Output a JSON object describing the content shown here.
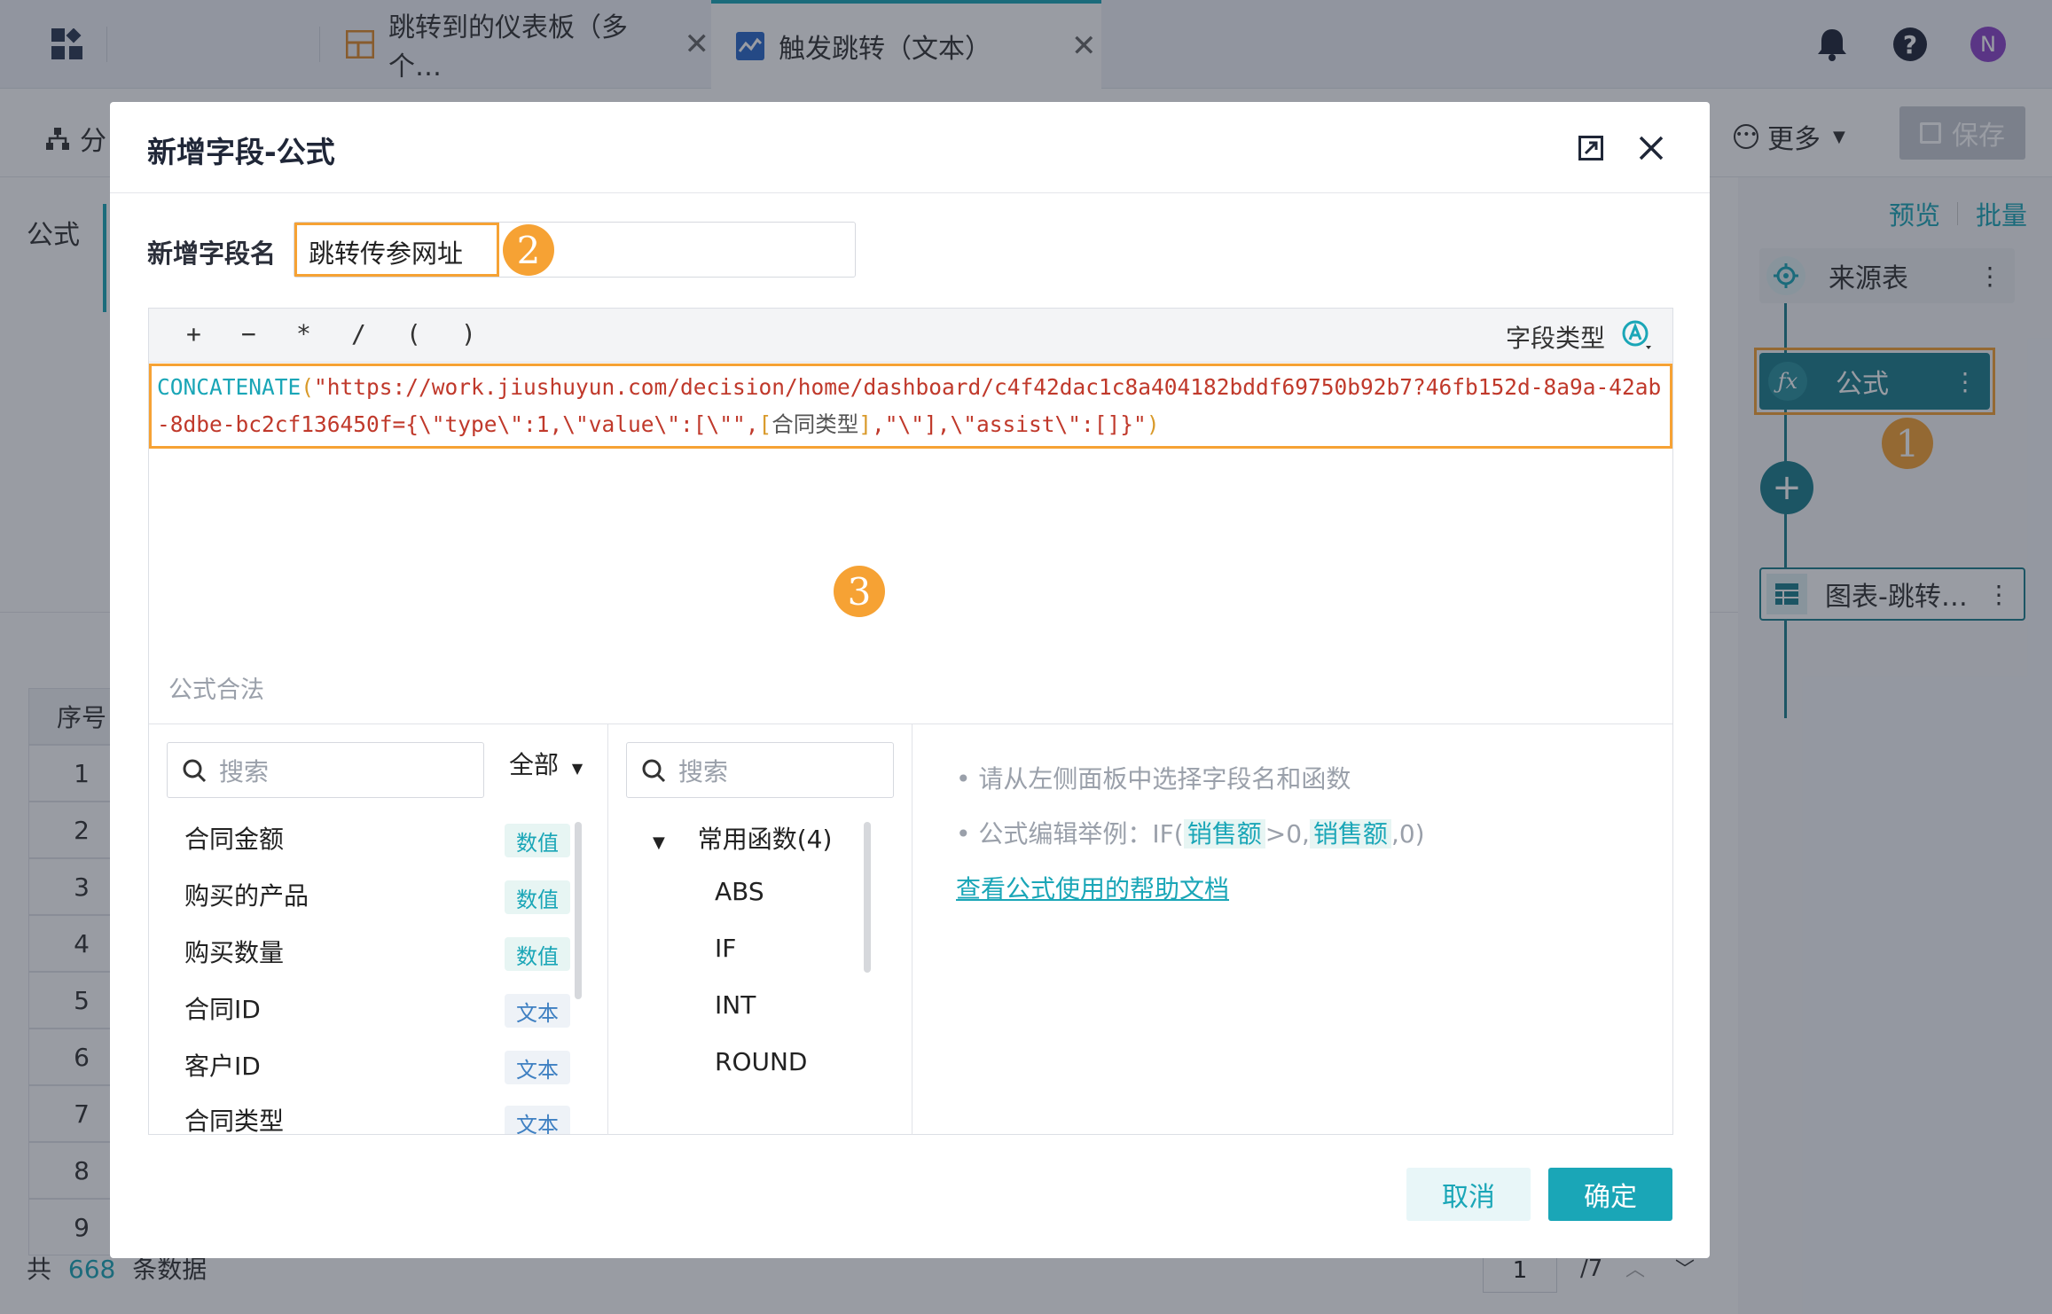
{
  "tabs": [
    {
      "label": "跳转到的仪表板（多个…",
      "close": "✕"
    },
    {
      "label": "触发跳转（文本）",
      "close": "✕"
    }
  ],
  "header": {
    "user_initial": "N"
  },
  "toolbar": {
    "left_label": "分",
    "more_label": "更多",
    "save_label": "保存"
  },
  "left": {
    "formula_label": "公式",
    "col_header": "序号",
    "row_numbers": [
      "1",
      "2",
      "3",
      "4",
      "5",
      "6",
      "7",
      "8",
      "9"
    ]
  },
  "footer": {
    "total_prefix": "共",
    "total_count": "668",
    "total_suffix": "条数据",
    "page": "1",
    "page_total": "/7"
  },
  "right": {
    "preview": "预览",
    "batch": "批量",
    "nodes": [
      {
        "label": "来源表",
        "icon": "source-icon"
      },
      {
        "label": "公式",
        "icon": "fx-icon"
      },
      {
        "label": "图表-跳转…",
        "icon": "table-icon"
      }
    ],
    "markers": {
      "one": "1"
    }
  },
  "dialog": {
    "title": "新增字段-公式",
    "field_name_label": "新增字段名",
    "field_name_value": "跳转传参网址",
    "markers": {
      "two": "2",
      "three": "3"
    },
    "operators": [
      "+",
      "−",
      "*",
      "/",
      "(",
      ")"
    ],
    "field_type_label": "字段类型",
    "formula": {
      "fn": "CONCATENATE",
      "open": "(",
      "str1": "\"https://work.jiushuyun.com/decision/home/dashboard/c4f42dac1c8a404182bddf69750b92b7?46fb152d-8a9a-42ab-8dbe-bc2cf136450f={\\\"type\\\":1,\\\"value\\\":[\\\"\",",
      "field_open": "[",
      "field_name": "合同类型",
      "field_close": "]",
      "str2": ",\"\\\"],\\\"assist\\\":[]}\"",
      "close": ")"
    },
    "validity": "公式合法",
    "field_search_placeholder": "搜索",
    "scope_select": "全部",
    "fields": [
      {
        "name": "合同金额",
        "type": "数值"
      },
      {
        "name": "购买的产品",
        "type": "数值"
      },
      {
        "name": "购买数量",
        "type": "数值"
      },
      {
        "name": "合同ID",
        "type": "文本"
      },
      {
        "name": "客户ID",
        "type": "文本"
      },
      {
        "name": "合同类型",
        "type": "文本"
      }
    ],
    "fn_search_placeholder": "搜索",
    "fn_group": "常用函数(4)",
    "functions": [
      "ABS",
      "IF",
      "INT",
      "ROUND"
    ],
    "tips": {
      "line1": "• 请从左侧面板中选择字段名和函数",
      "line2_prefix": "• 公式编辑举例：IF(",
      "line2_field1": "销售额",
      "line2_mid": ">0,",
      "line2_field2": "销售额",
      "line2_suffix": ",0)"
    },
    "help_link": "查看公式使用的帮助文档",
    "cancel": "取消",
    "confirm": "确定"
  },
  "colors": {
    "accent": "#1aa6b7",
    "highlight": "#f6a234",
    "node_active": "#1d7f8c"
  }
}
